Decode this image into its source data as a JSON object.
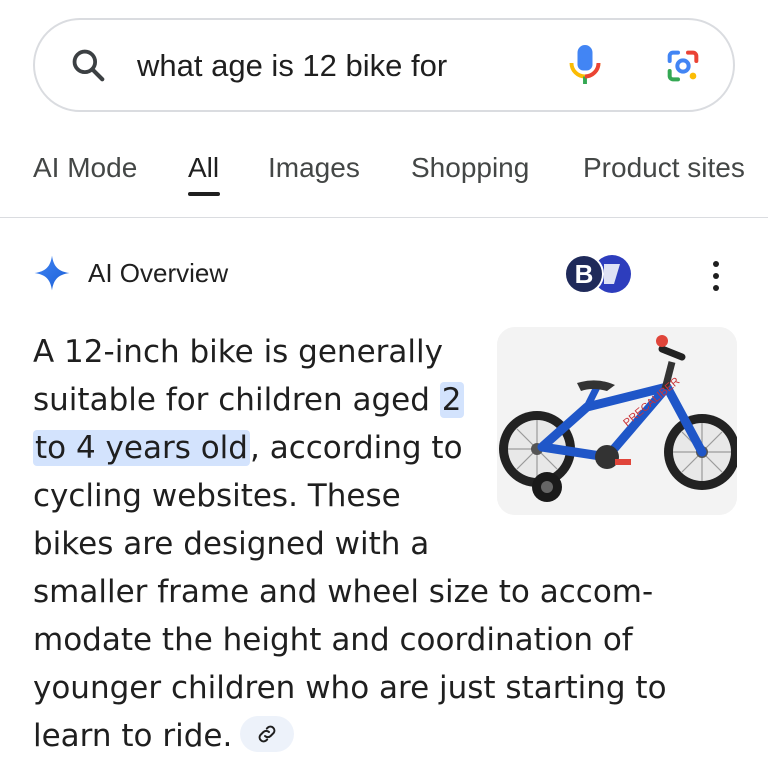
{
  "search": {
    "query": "what age is 12 bike for"
  },
  "tabs": [
    {
      "label": "AI Mode",
      "active": false
    },
    {
      "label": "All",
      "active": true
    },
    {
      "label": "Images",
      "active": false
    },
    {
      "label": "Shopping",
      "active": false
    },
    {
      "label": "Product sites",
      "active": false
    }
  ],
  "ai_overview": {
    "title": "AI Overview",
    "source_badge_letter": "B",
    "answer_lines": {
      "l1": "A 12-inch bike is generally",
      "l2_pre": "suitable for children aged ",
      "l2_hl": "2",
      "l3_hl": "to 4 years old",
      "l3_post": ", according to",
      "l4": "cycling websites. These",
      "l5": "bikes are designed with a",
      "l6": "smaller frame and wheel size to accom-",
      "l7": "modate the height and coordination of",
      "l8": "younger children who are just starting to",
      "l9": "learn to ride."
    }
  },
  "colors": {
    "highlight": "#d3e3fd",
    "accent_blue": "#4285f4",
    "mic_red": "#ea4335",
    "mic_yellow": "#fbbc04",
    "mic_green": "#34a853",
    "badge_navy": "#1f2a5a"
  },
  "icons": [
    "search-icon",
    "mic-icon",
    "google-lens-icon",
    "sparkle-icon",
    "more-vert-icon",
    "link-icon"
  ]
}
